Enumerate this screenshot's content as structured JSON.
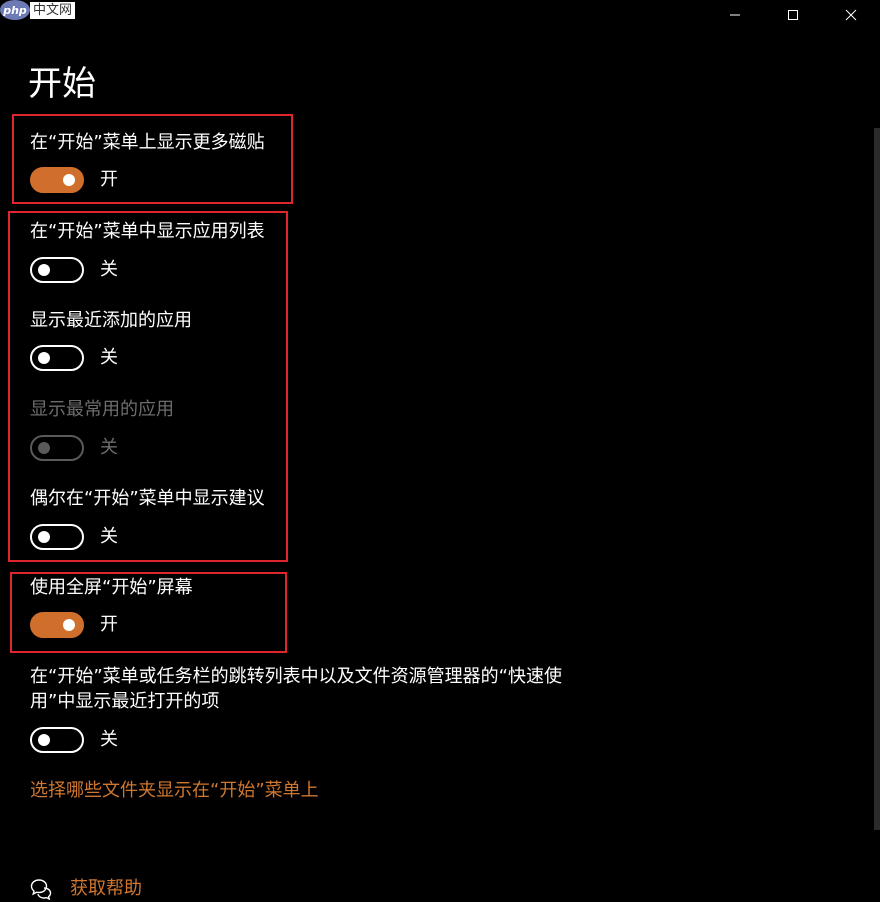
{
  "watermark": {
    "logo": "php",
    "text": "中文网"
  },
  "window": {
    "minimize_icon": "minimize-icon",
    "maximize_icon": "maximize-icon",
    "close_icon": "close-icon"
  },
  "page": {
    "title": "开始"
  },
  "settings": [
    {
      "label": "在“开始”菜单上显示更多磁贴",
      "state": "开",
      "on": true,
      "disabled": false
    },
    {
      "label": "在“开始”菜单中显示应用列表",
      "state": "关",
      "on": false,
      "disabled": false
    },
    {
      "label": "显示最近添加的应用",
      "state": "关",
      "on": false,
      "disabled": false
    },
    {
      "label": "显示最常用的应用",
      "state": "关",
      "on": false,
      "disabled": true
    },
    {
      "label": "偶尔在“开始”菜单中显示建议",
      "state": "关",
      "on": false,
      "disabled": false
    },
    {
      "label": "使用全屏“开始”屏幕",
      "state": "开",
      "on": true,
      "disabled": false
    },
    {
      "label_line1": "在“开始”菜单或任务栏的跳转列表中以及文件资源管理器的“快速使",
      "label_line2": "用”中显示最近打开的项",
      "state": "关",
      "on": false,
      "disabled": false
    }
  ],
  "link": {
    "label": "选择哪些文件夹显示在“开始”菜单上"
  },
  "help": {
    "icon": "chat-help-icon",
    "label": "获取帮助"
  },
  "colors": {
    "accent": "#cf6f2b",
    "link": "#d0772f",
    "highlight": "#e0252c",
    "background": "#000000",
    "disabled": "#6d6d6d"
  }
}
